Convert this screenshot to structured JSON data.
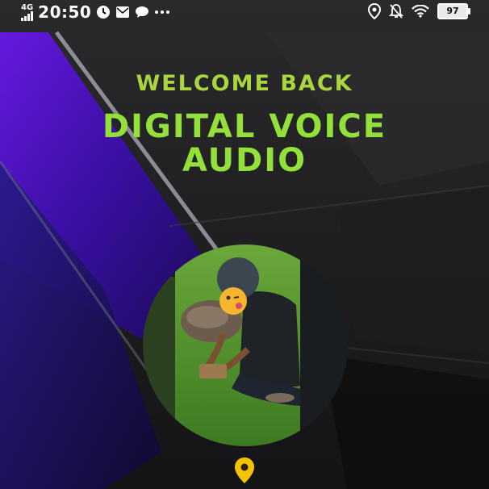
{
  "status_bar": {
    "network": "4G",
    "time": "20:50",
    "icons_left": [
      "signal-bars-icon",
      "clock-icon",
      "mail-icon",
      "chat-icon",
      "more-dots-icon"
    ],
    "icons_right": [
      "location-icon",
      "notification-off-icon",
      "wifi-icon",
      "battery-icon"
    ],
    "battery": "97"
  },
  "main": {
    "welcome": "WELCOME BACK",
    "title_line1": "DIGITAL VOICE",
    "title_line2": "AUDIO"
  },
  "colors": {
    "accent_green": "#93e03a",
    "welcome_green": "#a9d63d",
    "purple": "#4a10c8",
    "pin_yellow": "#f5c400"
  },
  "profile": {
    "icon": "user-photo-avatar"
  },
  "location_pin": {
    "icon": "map-pin-icon"
  }
}
